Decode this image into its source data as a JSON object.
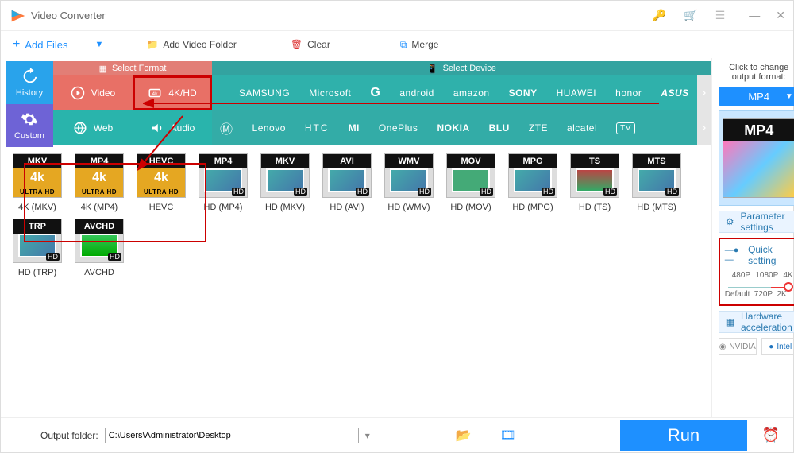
{
  "title": "Video Converter",
  "toolbar": {
    "add_files": "Add Files",
    "add_folder": "Add Video Folder",
    "clear": "Clear",
    "merge": "Merge"
  },
  "sidetabs": {
    "history": "History",
    "custom": "Custom"
  },
  "fmt_headers": {
    "select_format": "Select Format",
    "select_device": "Select Device"
  },
  "categories": {
    "video": "Video",
    "fourk_hd": "4K/HD",
    "web": "Web",
    "audio": "Audio"
  },
  "brands_row1": [
    "SAMSUNG",
    "Microsoft",
    "G",
    "android",
    "amazon",
    "SONY",
    "HUAWEI",
    "honor",
    "ASUS"
  ],
  "brands_row2": [
    "Lenovo",
    "HTC",
    "MI",
    "OnePlus",
    "NOKIA",
    "BLU",
    "ZTE",
    "alcatel",
    "TV"
  ],
  "formats": [
    {
      "top": "MKV",
      "label": "4K (MKV)",
      "style": "uhd"
    },
    {
      "top": "MP4",
      "label": "4K (MP4)",
      "style": "uhd"
    },
    {
      "top": "HEVC",
      "label": "HEVC",
      "style": "uhd"
    },
    {
      "top": "MP4",
      "label": "HD (MP4)",
      "style": "hd"
    },
    {
      "top": "MKV",
      "label": "HD (MKV)",
      "style": "hd"
    },
    {
      "top": "AVI",
      "label": "HD (AVI)",
      "style": "hd"
    },
    {
      "top": "WMV",
      "label": "HD (WMV)",
      "style": "hd"
    },
    {
      "top": "MOV",
      "label": "HD (MOV)",
      "style": "hd mov"
    },
    {
      "top": "MPG",
      "label": "HD (MPG)",
      "style": "hd"
    },
    {
      "top": "TS",
      "label": "HD (TS)",
      "style": "hd ts"
    },
    {
      "top": "MTS",
      "label": "HD (MTS)",
      "style": "hd"
    },
    {
      "top": "TRP",
      "label": "HD (TRP)",
      "style": "hd"
    },
    {
      "top": "AVCHD",
      "label": "AVCHD",
      "style": "hd hevc"
    }
  ],
  "uhd_mid": "4k",
  "uhd_bot": "ULTRA HD",
  "hd_badge": "HD",
  "right": {
    "click_label": "Click to change output format:",
    "selected": "MP4",
    "preview_top": "MP4",
    "param_btn": "Parameter settings",
    "quick_title": "Quick setting",
    "scale_top": [
      "480P",
      "1080P",
      "4K"
    ],
    "scale_bot": [
      "Default",
      "720P",
      "2K"
    ],
    "hw_btn": "Hardware acceleration",
    "nvidia": "NVIDIA",
    "intel": "Intel"
  },
  "bottom": {
    "label": "Output folder:",
    "path": "C:\\Users\\Administrator\\Desktop",
    "run": "Run"
  }
}
